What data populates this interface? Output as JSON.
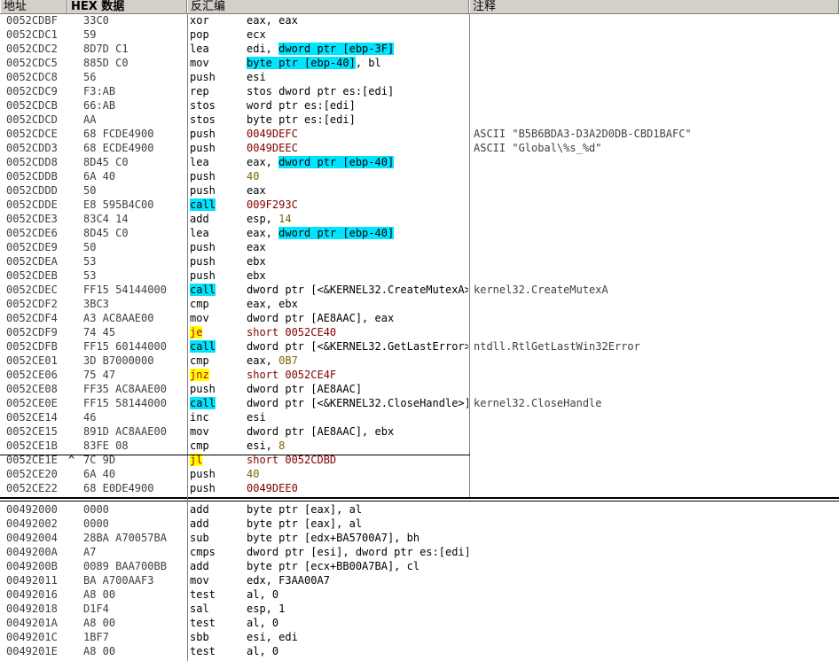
{
  "header": {
    "addr_label": "地址",
    "hex_label": "HEX 数据",
    "disasm_label": "反汇编",
    "comment_label": "注释"
  },
  "top_rows": [
    {
      "addr": "0052CDBF",
      "hex": "33C0",
      "mnem": "xor",
      "ops": [
        {
          "t": "eax, eax"
        }
      ],
      "comment": ""
    },
    {
      "addr": "0052CDC1",
      "hex": "59",
      "mnem": "pop",
      "ops": [
        {
          "t": "ecx"
        }
      ],
      "comment": ""
    },
    {
      "addr": "0052CDC2",
      "hex": "8D7D C1",
      "mnem": "lea",
      "ops": [
        {
          "t": "edi, "
        },
        {
          "t": "dword ptr [ebp-3F]",
          "c": "hl-c"
        }
      ],
      "comment": ""
    },
    {
      "addr": "0052CDC5",
      "hex": "885D C0",
      "mnem": "mov",
      "ops": [
        {
          "t": "byte ptr [ebp-40]",
          "c": "hl-c"
        },
        {
          "t": ", bl"
        }
      ],
      "comment": ""
    },
    {
      "addr": "0052CDC8",
      "hex": "56",
      "mnem": "push",
      "ops": [
        {
          "t": "esi"
        }
      ],
      "comment": ""
    },
    {
      "addr": "0052CDC9",
      "hex": "F3:AB",
      "mnem": "rep",
      "ops": [
        {
          "t": "stos dword ptr es:[edi]"
        }
      ],
      "comment": ""
    },
    {
      "addr": "0052CDCB",
      "hex": "66:AB",
      "mnem": "stos",
      "ops": [
        {
          "t": "word ptr es:[edi]"
        }
      ],
      "comment": ""
    },
    {
      "addr": "0052CDCD",
      "hex": "AA",
      "mnem": "stos",
      "ops": [
        {
          "t": "byte ptr es:[edi]"
        }
      ],
      "comment": ""
    },
    {
      "addr": "0052CDCE",
      "hex": "68 FCDE4900",
      "mnem": "push",
      "ops": [
        {
          "t": "0049DEFC",
          "c": "addrv"
        }
      ],
      "comment": "ASCII \"B5B6BDA3-D3A2D0DB-CBD1BAFC\""
    },
    {
      "addr": "0052CDD3",
      "hex": "68 ECDE4900",
      "mnem": "push",
      "ops": [
        {
          "t": "0049DEEC",
          "c": "addrv"
        }
      ],
      "comment": "ASCII \"Global\\%s_%d\""
    },
    {
      "addr": "0052CDD8",
      "hex": "8D45 C0",
      "mnem": "lea",
      "ops": [
        {
          "t": "eax, "
        },
        {
          "t": "dword ptr [ebp-40]",
          "c": "hl-c"
        }
      ],
      "comment": ""
    },
    {
      "addr": "0052CDDB",
      "hex": "6A 40",
      "mnem": "push",
      "ops": [
        {
          "t": "40",
          "c": "num"
        }
      ],
      "comment": ""
    },
    {
      "addr": "0052CDDD",
      "hex": "50",
      "mnem": "push",
      "ops": [
        {
          "t": "eax"
        }
      ],
      "comment": ""
    },
    {
      "addr": "0052CDDE",
      "hex": "E8 595B4C00",
      "mnem": "call",
      "mc": "hl-c",
      "ops": [
        {
          "t": "009F293C",
          "c": "addrv"
        }
      ],
      "comment": ""
    },
    {
      "addr": "0052CDE3",
      "hex": "83C4 14",
      "mnem": "add",
      "ops": [
        {
          "t": "esp, "
        },
        {
          "t": "14",
          "c": "num"
        }
      ],
      "comment": ""
    },
    {
      "addr": "0052CDE6",
      "hex": "8D45 C0",
      "mnem": "lea",
      "ops": [
        {
          "t": "eax, "
        },
        {
          "t": "dword ptr [ebp-40]",
          "c": "hl-c"
        }
      ],
      "comment": ""
    },
    {
      "addr": "0052CDE9",
      "hex": "50",
      "mnem": "push",
      "ops": [
        {
          "t": "eax"
        }
      ],
      "comment": ""
    },
    {
      "addr": "0052CDEA",
      "hex": "53",
      "mnem": "push",
      "ops": [
        {
          "t": "ebx"
        }
      ],
      "comment": ""
    },
    {
      "addr": "0052CDEB",
      "hex": "53",
      "mnem": "push",
      "ops": [
        {
          "t": "ebx"
        }
      ],
      "comment": ""
    },
    {
      "addr": "0052CDEC",
      "hex": "FF15 54144000",
      "mnem": "call",
      "mc": "hl-c",
      "ops": [
        {
          "t": "dword ptr [<&KERNEL32.CreateMutexA>]"
        }
      ],
      "comment": "kernel32.CreateMutexA"
    },
    {
      "addr": "0052CDF2",
      "hex": "3BC3",
      "mnem": "cmp",
      "ops": [
        {
          "t": "eax, ebx"
        }
      ],
      "comment": ""
    },
    {
      "addr": "0052CDF4",
      "hex": "A3 AC8AAE00",
      "mnem": "mov",
      "ops": [
        {
          "t": "dword ptr [AE8AAC], eax"
        }
      ],
      "comment": ""
    },
    {
      "addr": "0052CDF9",
      "hex": "74 45",
      "mnem": "je",
      "mc": "hl-y",
      "ops": [
        {
          "t": "short 0052CE40",
          "c": "addrv"
        }
      ],
      "comment": ""
    },
    {
      "addr": "0052CDFB",
      "hex": "FF15 60144000",
      "mnem": "call",
      "mc": "hl-c",
      "ops": [
        {
          "t": "dword ptr [<&KERNEL32.GetLastError>]"
        }
      ],
      "comment": "ntdll.RtlGetLastWin32Error"
    },
    {
      "addr": "0052CE01",
      "hex": "3D B7000000",
      "mnem": "cmp",
      "ops": [
        {
          "t": "eax, "
        },
        {
          "t": "0B7",
          "c": "num"
        }
      ],
      "comment": ""
    },
    {
      "addr": "0052CE06",
      "hex": "75 47",
      "mnem": "jnz",
      "mc": "hl-y",
      "ops": [
        {
          "t": "short 0052CE4F",
          "c": "addrv"
        }
      ],
      "comment": ""
    },
    {
      "addr": "0052CE08",
      "hex": "FF35 AC8AAE00",
      "mnem": "push",
      "ops": [
        {
          "t": "dword ptr [AE8AAC]"
        }
      ],
      "comment": ""
    },
    {
      "addr": "0052CE0E",
      "hex": "FF15 58144000",
      "mnem": "call",
      "mc": "hl-c",
      "ops": [
        {
          "t": "dword ptr [<&KERNEL32.CloseHandle>]"
        }
      ],
      "comment": "kernel32.CloseHandle"
    },
    {
      "addr": "0052CE14",
      "hex": "46",
      "mnem": "inc",
      "ops": [
        {
          "t": "esi"
        }
      ],
      "comment": ""
    },
    {
      "addr": "0052CE15",
      "hex": "891D AC8AAE00",
      "mnem": "mov",
      "ops": [
        {
          "t": "dword ptr [AE8AAC], ebx"
        }
      ],
      "comment": ""
    },
    {
      "addr": "0052CE1B",
      "hex": "83FE 08",
      "mnem": "cmp",
      "ops": [
        {
          "t": "esi, "
        },
        {
          "t": "8",
          "c": "num"
        }
      ],
      "comment": ""
    },
    {
      "addr": "0052CE1E",
      "mark": "^",
      "hex": "7C 9D",
      "mnem": "jl",
      "mc": "hl-y",
      "ops": [
        {
          "t": "short 0052CDBD",
          "c": "addrv"
        }
      ],
      "comment": ""
    },
    {
      "addr": "0052CE20",
      "hex": "6A 40",
      "mnem": "push",
      "ops": [
        {
          "t": "40",
          "c": "num"
        }
      ],
      "comment": ""
    },
    {
      "addr": "0052CE22",
      "hex": "68 E0DE4900",
      "mnem": "push",
      "ops": [
        {
          "t": "0049DEE0",
          "c": "addrv"
        }
      ],
      "comment": ""
    }
  ],
  "bottom_rows": [
    {
      "addr": "00492000",
      "hex": "0000",
      "mnem": "add",
      "ops": [
        {
          "t": "byte ptr [eax], al"
        }
      ]
    },
    {
      "addr": "00492002",
      "hex": "0000",
      "mnem": "add",
      "ops": [
        {
          "t": "byte ptr [eax], al"
        }
      ]
    },
    {
      "addr": "00492004",
      "hex": "28BA A70057BA",
      "mnem": "sub",
      "ops": [
        {
          "t": "byte ptr [edx+BA5700A7], bh"
        }
      ]
    },
    {
      "addr": "0049200A",
      "hex": "A7",
      "mnem": "cmps",
      "ops": [
        {
          "t": "dword ptr [esi], dword ptr es:[edi]"
        }
      ]
    },
    {
      "addr": "0049200B",
      "hex": "0089 BAA700BB",
      "mnem": "add",
      "ops": [
        {
          "t": "byte ptr [ecx+BB00A7BA], cl"
        }
      ]
    },
    {
      "addr": "00492011",
      "hex": "BA A700AAF3",
      "mnem": "mov",
      "ops": [
        {
          "t": "edx, F3AA00A7"
        }
      ]
    },
    {
      "addr": "00492016",
      "hex": "A8 00",
      "mnem": "test",
      "ops": [
        {
          "t": "al, 0"
        }
      ]
    },
    {
      "addr": "00492018",
      "hex": "D1F4",
      "mnem": "sal",
      "ops": [
        {
          "t": "esp, 1"
        }
      ]
    },
    {
      "addr": "0049201A",
      "hex": "A8 00",
      "mnem": "test",
      "ops": [
        {
          "t": "al, 0"
        }
      ]
    },
    {
      "addr": "0049201C",
      "hex": "1BF7",
      "mnem": "sbb",
      "ops": [
        {
          "t": "esi, edi"
        }
      ]
    },
    {
      "addr": "0049201E",
      "hex": "A8 00",
      "mnem": "test",
      "ops": [
        {
          "t": "al, 0"
        }
      ]
    }
  ]
}
